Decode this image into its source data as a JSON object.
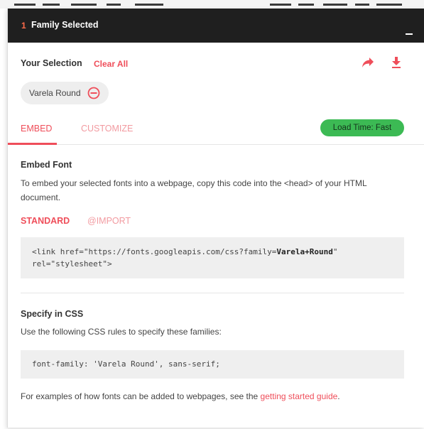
{
  "header": {
    "count": "1",
    "title": "Family Selected",
    "minimize_icon": "minimize-icon"
  },
  "selection": {
    "label": "Your Selection",
    "clear_all": "Clear All",
    "share_icon": "share-arrow-icon",
    "download_icon": "download-icon",
    "chips": [
      {
        "name": "Varela Round",
        "remove_icon": "remove-circle-icon"
      }
    ]
  },
  "tabs": [
    {
      "label": "EMBED",
      "active": true
    },
    {
      "label": "CUSTOMIZE",
      "active": false
    }
  ],
  "load_time": "Load Time: Fast",
  "embed": {
    "heading": "Embed Font",
    "description": "To embed your selected fonts into a webpage, copy this code into the <head> of your HTML document.",
    "subtabs": [
      {
        "label": "STANDARD",
        "active": true
      },
      {
        "label": "@IMPORT",
        "active": false
      }
    ],
    "code_prefix": "<link href=\"https://fonts.googleapis.com/css?family=",
    "code_family": "Varela+Round",
    "code_suffix": "\" rel=\"stylesheet\">"
  },
  "css": {
    "heading": "Specify in CSS",
    "description": "Use the following CSS rules to specify these families:",
    "rule": "font-family: 'Varela Round', sans-serif;"
  },
  "footer": {
    "text": "For examples of how fonts can be added to webpages, see the ",
    "link": "getting started guide",
    "end": "."
  },
  "colors": {
    "accent": "#ef4e5a",
    "header_bg": "#1f1f1f",
    "badge_green": "#3cba54"
  }
}
